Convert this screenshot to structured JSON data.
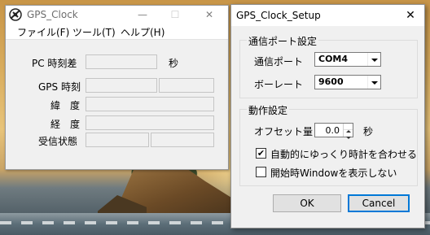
{
  "gps_clock": {
    "title": "GPS_Clock",
    "menu": [
      "ファイル(F)",
      "ツール(T)",
      "ヘルプ(H)"
    ],
    "pc_diff_label": "PC 時刻差",
    "pc_diff_unit": "秒",
    "gps_time_label": "GPS 時刻",
    "latitude_label": "緯　度",
    "longitude_label": "経　度",
    "rx_status_label": "受信状態"
  },
  "setup": {
    "title": "GPS_Clock_Setup",
    "comm_group": "通信ポート設定",
    "port_label": "通信ポート",
    "port_value": "COM4",
    "baud_label": "ボーレート",
    "baud_value": "9600",
    "action_group": "動作設定",
    "offset_label": "オフセット量",
    "offset_value": "0.0",
    "offset_unit": "秒",
    "auto_adjust_label": "自動的にゆっくり時計を合わせる",
    "auto_adjust_checked": true,
    "hide_window_label": "開始時Windowを表示しない",
    "hide_window_checked": false,
    "ok_label": "OK",
    "cancel_label": "Cancel"
  },
  "icons": {
    "app_icon": "satellite-icon",
    "minimize": "minimize-icon",
    "maximize": "maximize-icon",
    "close": "close-icon",
    "dropdown": "chevron-down-icon",
    "spin_up": "arrow-up-icon",
    "spin_down": "arrow-down-icon",
    "check": "checkmark-icon"
  },
  "glyphs": {
    "minimize": "—",
    "maximize": "☐",
    "close": "✕",
    "check": "✔"
  },
  "colors": {
    "default_button_border": "#0078d7"
  }
}
